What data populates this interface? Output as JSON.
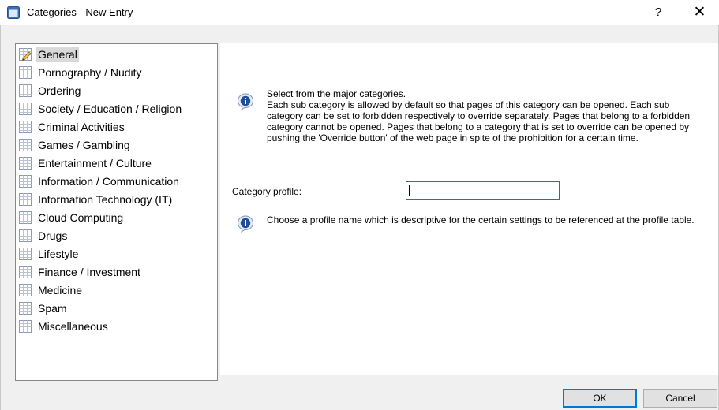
{
  "window": {
    "title": "Categories - New Entry",
    "help_label": "?",
    "close_label": "✕"
  },
  "tree": {
    "items": [
      {
        "label": "General",
        "selected": true
      },
      {
        "label": "Pornography / Nudity"
      },
      {
        "label": "Ordering"
      },
      {
        "label": "Society / Education / Religion"
      },
      {
        "label": "Criminal Activities"
      },
      {
        "label": "Games / Gambling"
      },
      {
        "label": "Entertainment / Culture"
      },
      {
        "label": "Information / Communication"
      },
      {
        "label": "Information Technology (IT)"
      },
      {
        "label": "Cloud Computing"
      },
      {
        "label": "Drugs"
      },
      {
        "label": "Lifestyle"
      },
      {
        "label": "Finance / Investment"
      },
      {
        "label": "Medicine"
      },
      {
        "label": "Spam"
      },
      {
        "label": "Miscellaneous"
      }
    ]
  },
  "general": {
    "info1_line1": "Select from the major categories.",
    "info1_line2": "Each sub category is allowed by default so that pages of this category can be opened. Each sub category can be set to forbidden respectively to override separately. Pages that belong to a forbidden category cannot be opened. Pages that belong to a category that is set to override can be opened by pushing the 'Override button' of the web page in spite of the prohibition for a certain time.",
    "profile_label": "Category profile:",
    "profile_value": "",
    "info2": "Choose a profile name which is descriptive for the certain settings to be referenced at the profile table."
  },
  "buttons": {
    "ok": "OK",
    "cancel": "Cancel"
  },
  "colors": {
    "accent": "#0078d7",
    "info_icon": "#1f4e96"
  }
}
